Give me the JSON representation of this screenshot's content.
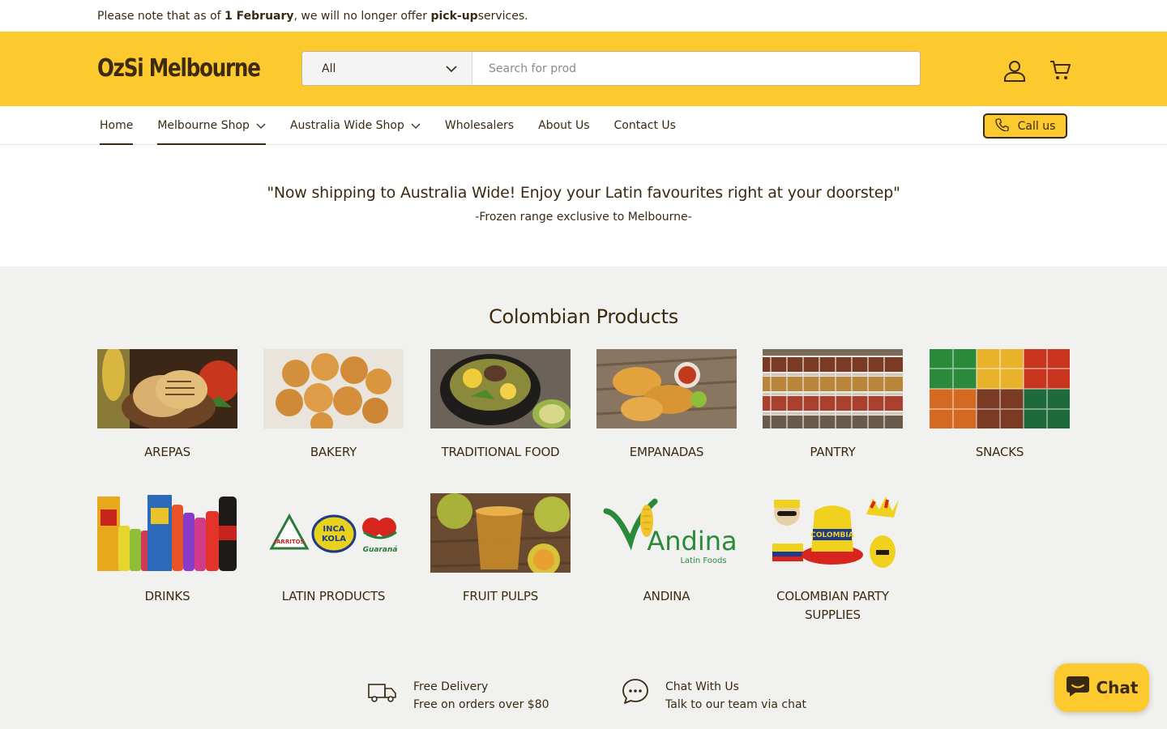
{
  "announcement": {
    "prefix": "Please note that as of ",
    "date": "1 February",
    "middle": ", we will no longer offer ",
    "service": "pick-up",
    "suffix": " services."
  },
  "header": {
    "logo": "OzSi Melbourne",
    "search_category": "All",
    "search_placeholder": "Search for prod",
    "brand_color": "#fcca2e",
    "icons": [
      "user-icon",
      "cart-icon"
    ]
  },
  "nav": {
    "items": [
      {
        "label": "Home",
        "active": true
      },
      {
        "label": "Melbourne Shop",
        "active": true,
        "dropdown": true
      },
      {
        "label": "Australia Wide Shop",
        "dropdown": true
      },
      {
        "label": "Wholesalers"
      },
      {
        "label": "About Us"
      },
      {
        "label": "Contact Us"
      }
    ],
    "call_label": "Call us"
  },
  "promo": {
    "quote": "\"Now shipping to Australia Wide! Enjoy your Latin favourites right at your doorstep\"",
    "sub": "-Frozen range exclusive to Melbourne-"
  },
  "collections": {
    "title": "Colombian Products",
    "items": [
      {
        "label": "AREPAS",
        "image": "arepas-image"
      },
      {
        "label": "BAKERY",
        "image": "bakery-image"
      },
      {
        "label": "TRADITIONAL FOOD",
        "image": "traditional-food-image"
      },
      {
        "label": "EMPANADAS",
        "image": "empanadas-image"
      },
      {
        "label": "PANTRY",
        "image": "pantry-image"
      },
      {
        "label": "SNACKS",
        "image": "snacks-image"
      },
      {
        "label": "DRINKS",
        "image": "drinks-image"
      },
      {
        "label": "LATIN PRODUCTS",
        "image": "latin-products-image"
      },
      {
        "label": "FRUIT PULPS",
        "image": "fruit-pulps-image"
      },
      {
        "label": "ANDINA",
        "image": "andina-logo-image"
      },
      {
        "label": "COLOMBIAN PARTY SUPPLIES",
        "image": "party-supplies-image"
      }
    ],
    "logos": {
      "jarritos": "JARRITOS",
      "inca_kola_1": "INCA",
      "inca_kola_2": "KOLA",
      "guarana": "Guaraná",
      "andina_word": "Andina",
      "andina_sub": "Latin Foods",
      "colombia_hat": "COLOMBIA"
    }
  },
  "features": [
    {
      "title": "Free Delivery",
      "text": "Free on orders over $80",
      "icon": "truck-icon"
    },
    {
      "title": "Chat With Us",
      "text": "Talk to our team via chat",
      "icon": "chat-bubble-icon"
    }
  ],
  "chat_widget": {
    "label": "Chat",
    "icon": "chat-icon"
  }
}
